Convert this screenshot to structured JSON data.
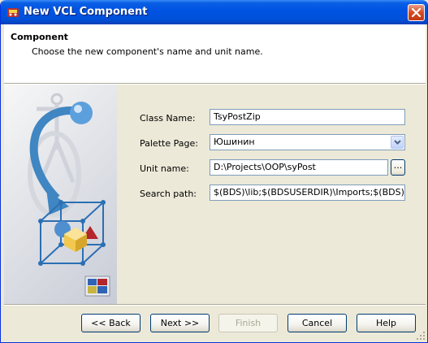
{
  "window": {
    "title": "New VCL Component"
  },
  "header": {
    "title": "Component",
    "subtitle": "Choose the new component's name and unit name."
  },
  "form": {
    "class_name": {
      "label": "Class Name:",
      "value": "TsyPostZip"
    },
    "palette_page": {
      "label": "Palette Page:",
      "value": "Юшинин"
    },
    "unit_name": {
      "label": "Unit name:",
      "value": "D:\\Projects\\OOP\\syPost",
      "browse_label": "..."
    },
    "search_path": {
      "label": "Search path:",
      "value": "$(BDS)\\lib;$(BDSUSERDIR)\\Imports;$(BDS)\\Impor"
    }
  },
  "buttons": {
    "back": "<< Back",
    "next": "Next >>",
    "finish": "Finish",
    "cancel": "Cancel",
    "help": "Help"
  },
  "colors": {
    "titlebar": "#0054e3",
    "dialog_bg": "#ece9d8",
    "input_border": "#7f9db9"
  }
}
